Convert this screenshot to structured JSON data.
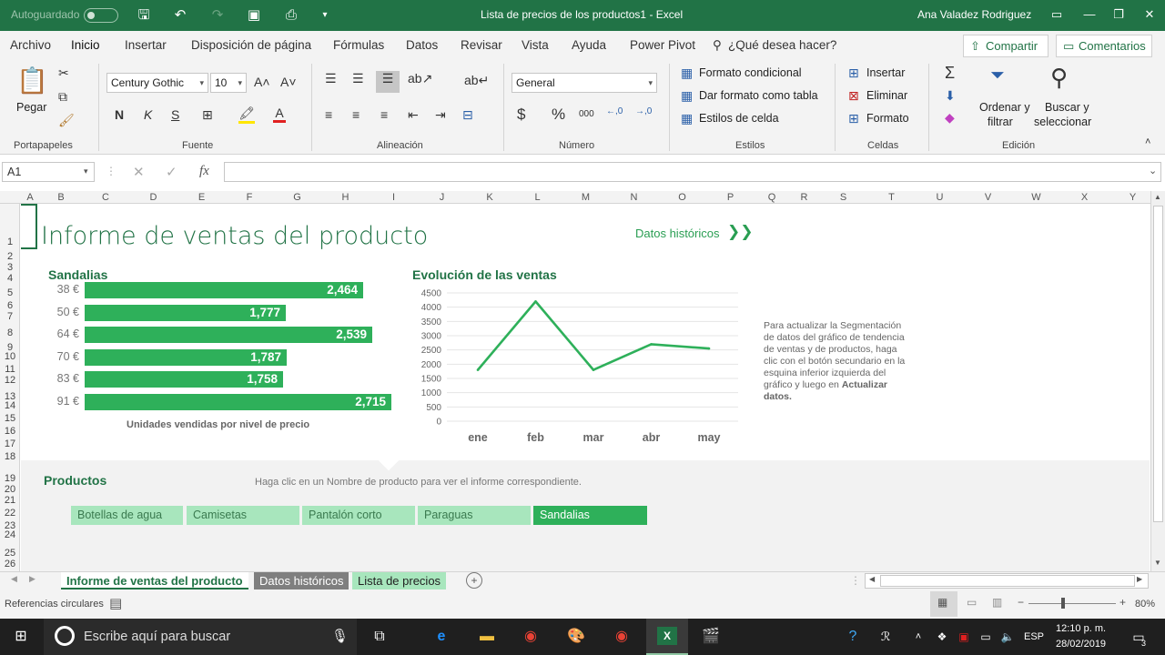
{
  "titlebar": {
    "autosave": "Autoguardado",
    "title": "Lista de precios de los productos1  -  Excel",
    "user": "Ana Valadez Rodriguez"
  },
  "menu": {
    "items": [
      "Archivo",
      "Inicio",
      "Insertar",
      "Disposición de página",
      "Fórmulas",
      "Datos",
      "Revisar",
      "Vista",
      "Ayuda",
      "Power Pivot"
    ],
    "search": "¿Qué desea hacer?",
    "share": "Compartir",
    "comments": "Comentarios"
  },
  "ribbon": {
    "paste": "Pegar",
    "font_name": "Century Gothic",
    "font_size": "10",
    "number_format": "General",
    "conditional_format": "Formato condicional",
    "format_as_table": "Dar formato como tabla",
    "cell_styles": "Estilos de celda",
    "insert": "Insertar",
    "delete": "Eliminar",
    "format": "Formato",
    "sort_filter_1": "Ordenar y",
    "sort_filter_2": "filtrar",
    "find_select_1": "Buscar y",
    "find_select_2": "seleccionar",
    "groups": {
      "clipboard": "Portapapeles",
      "font": "Fuente",
      "alignment": "Alineación",
      "number": "Número",
      "styles": "Estilos",
      "cells": "Celdas",
      "editing": "Edición"
    }
  },
  "formula_bar": {
    "name_box": "A1",
    "fx": "fx",
    "value": ""
  },
  "columns": [
    "A",
    "B",
    "C",
    "D",
    "E",
    "F",
    "G",
    "H",
    "I",
    "J",
    "K",
    "L",
    "M",
    "N",
    "O",
    "P",
    "Q",
    "R",
    "S",
    "T",
    "U",
    "V",
    "W",
    "X",
    "Y"
  ],
  "rows": [
    "1",
    "2",
    "3",
    "4",
    "5",
    "6",
    "7",
    "8",
    "9",
    "10",
    "11",
    "12",
    "13",
    "14",
    "15",
    "16",
    "17",
    "18",
    "19",
    "20",
    "21",
    "22",
    "23",
    "24",
    "25",
    "26"
  ],
  "report": {
    "title": "Informe de ventas del producto",
    "history_link": "Datos históricos",
    "bar_title": "Sandalias",
    "bar_caption": "Unidades vendidas por nivel de precio",
    "line_title": "Evolución de las ventas",
    "note_lines": [
      "Para actualizar la Segmentación",
      "de datos del gráfico de tendencia",
      "de ventas y de productos, haga",
      "clic con el botón secundario en la",
      "esquina inferior izquierda del",
      "gráfico y luego en"
    ],
    "note_bold_1": "Actualizar",
    "note_bold_2": "datos.",
    "products_title": "Productos",
    "products_hint": "Haga clic en un Nombre de producto para ver el informe correspondiente.",
    "slicers": [
      "Botellas de agua",
      "Camisetas",
      "Pantalón corto",
      "Paraguas",
      "Sandalias"
    ],
    "selected_slicer": "Sandalias"
  },
  "chart_data": [
    {
      "type": "bar",
      "title": "Sandalias",
      "xlabel": "Unidades vendidas por nivel de precio",
      "categories": [
        "38 €",
        "50 €",
        "64 €",
        "70 €",
        "83 €",
        "91 €"
      ],
      "values": [
        2464,
        1777,
        2539,
        1787,
        1758,
        2715
      ],
      "value_labels": [
        "2,464",
        "1,777",
        "2,539",
        "1,787",
        "1,758",
        "2,715"
      ],
      "color": "#2eb05a"
    },
    {
      "type": "line",
      "title": "Evolución de las ventas",
      "categories": [
        "ene",
        "feb",
        "mar",
        "abr",
        "may"
      ],
      "values": [
        1800,
        4200,
        1800,
        2700,
        2550
      ],
      "ylim": [
        0,
        4500
      ],
      "yticks": [
        "4500",
        "4000",
        "3500",
        "3000",
        "2500",
        "2000",
        "1500",
        "1000",
        "500",
        "0"
      ],
      "grid": true,
      "color": "#2eb05a"
    }
  ],
  "sheet_tabs": [
    "Informe de ventas del producto",
    "Datos históricos",
    "Lista de precios"
  ],
  "status": {
    "left": "Referencias circulares",
    "zoom": "80%"
  },
  "taskbar": {
    "search": "Escribe aquí para buscar",
    "lang": "ESP",
    "time": "12:10 p. m.",
    "date": "28/02/2019",
    "notif_count": "3"
  }
}
